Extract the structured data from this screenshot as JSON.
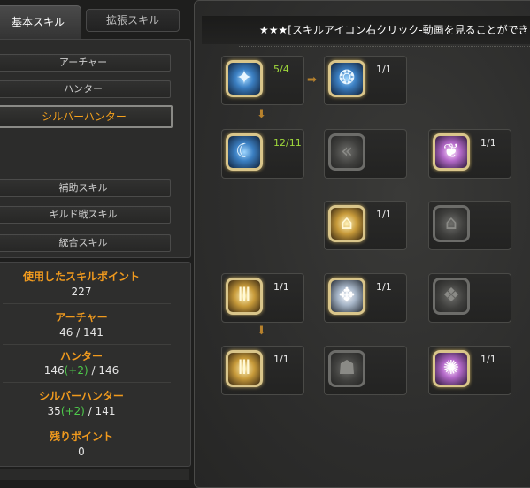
{
  "tabs": {
    "basic": "基本スキル",
    "extended": "拡張スキル"
  },
  "menu": {
    "items": [
      "アーチャー",
      "ハンター",
      "シルバーハンター",
      "補助スキル",
      "ギルド戦スキル",
      "統合スキル"
    ],
    "selected": "シルバーハンター"
  },
  "stats": {
    "used_label": "使用したスキルポイント",
    "used_value": "227",
    "archer_label": "アーチャー",
    "archer_value": "46 / 141",
    "hunter_label": "ハンター",
    "hunter_points": "146",
    "hunter_bonus": "(+2)",
    "hunter_max": "/ 146",
    "silver_label": "シルバーハンター",
    "silver_points": "35",
    "silver_bonus": "(+2)",
    "silver_max": "/ 141",
    "remaining_label": "残りポイント",
    "remaining_value": "0"
  },
  "header": {
    "hint": "★★★[スキルアイコン右クリック-動画を見ることができ"
  },
  "skills": {
    "s1": {
      "icon": "blue-wing-skill-icon",
      "count": "5/4",
      "learned": true
    },
    "s2": {
      "icon": "blue-crest-skill-icon",
      "count": "1/1",
      "learned": true
    },
    "s3": {
      "icon": "blue-crescent-skill-icon",
      "count": "12/11",
      "learned": true
    },
    "s4": {
      "icon": "locked-arrow-skill-icon",
      "count": "",
      "learned": false
    },
    "s5": {
      "icon": "purple-beast-skill-icon",
      "count": "1/1",
      "learned": true
    },
    "s6": {
      "icon": "gold-shrine-skill-icon",
      "count": "1/1",
      "learned": true
    },
    "s7": {
      "icon": "locked-shrine-skill-icon",
      "count": "",
      "learned": false
    },
    "s8": {
      "icon": "gold-pillar-skill-icon",
      "count": "1/1",
      "learned": true
    },
    "s9": {
      "icon": "silver-eagle-skill-icon",
      "count": "1/1",
      "learned": true
    },
    "s10": {
      "icon": "locked-rune-skill-icon",
      "count": "",
      "learned": false
    },
    "s11": {
      "icon": "gold-pillar-skill-icon",
      "count": "1/1",
      "learned": true
    },
    "s12": {
      "icon": "locked-mask-skill-icon",
      "count": "",
      "learned": false
    },
    "s13": {
      "icon": "purple-spiral-skill-icon",
      "count": "1/1",
      "learned": true
    }
  },
  "colors": {
    "accent_orange": "#f09a1e",
    "bonus_green": "#4ec94b",
    "count_green": "#9fd83b"
  }
}
